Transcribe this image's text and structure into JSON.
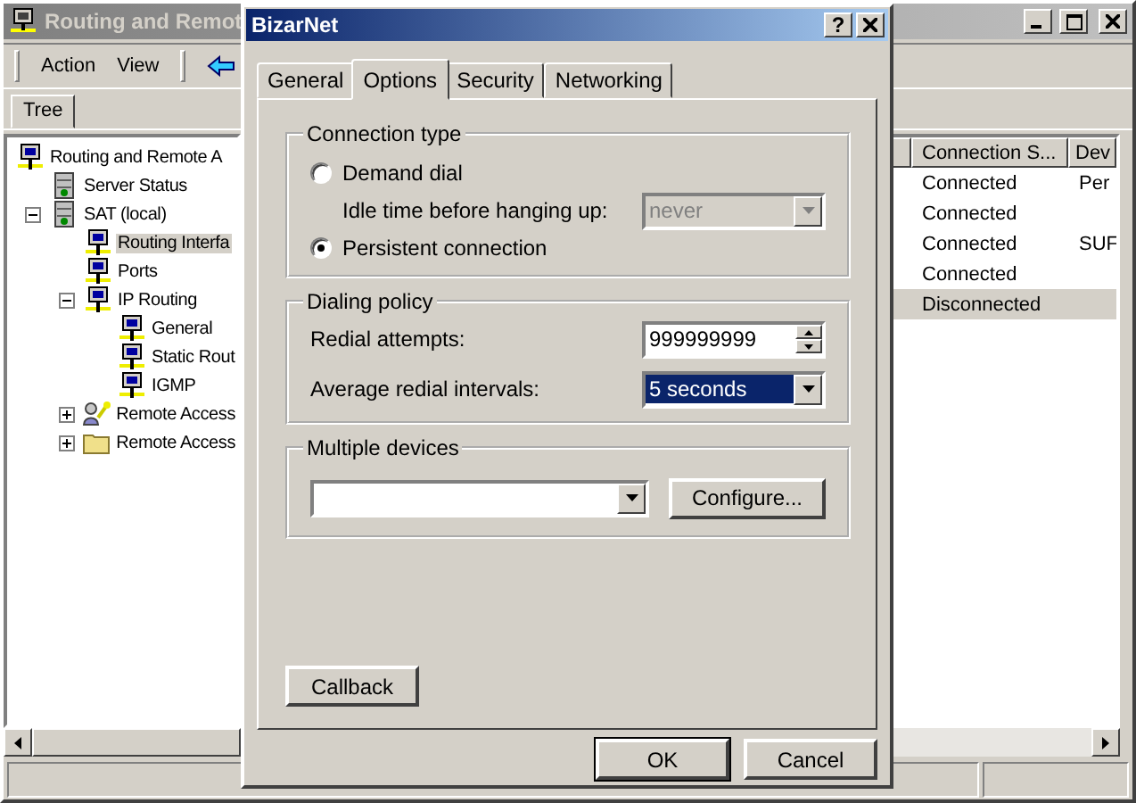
{
  "main_window": {
    "title": "Routing and Remot",
    "menu": [
      "Action",
      "View"
    ],
    "tree_tab": "Tree",
    "tree": [
      {
        "label": "Routing and Remote A",
        "kind": "computer",
        "selected": false,
        "children": [
          {
            "label": "Server Status",
            "kind": "server",
            "selected": false
          },
          {
            "label": "SAT (local)",
            "kind": "server",
            "selected": false,
            "expanded": true,
            "children": [
              {
                "label": "Routing Interfa",
                "kind": "computer",
                "selected": true
              },
              {
                "label": "Ports",
                "kind": "computer",
                "selected": false
              },
              {
                "label": "IP Routing",
                "kind": "computer",
                "selected": false,
                "expanded": true,
                "children": [
                  {
                    "label": "General",
                    "kind": "computer",
                    "selected": false
                  },
                  {
                    "label": "Static Rout",
                    "kind": "computer",
                    "selected": false
                  },
                  {
                    "label": "IGMP",
                    "kind": "computer",
                    "selected": false
                  }
                ]
              },
              {
                "label": "Remote Access",
                "kind": "policy",
                "selected": false,
                "expanded": false
              },
              {
                "label": "Remote Access",
                "kind": "folder",
                "selected": false,
                "expanded": false
              }
            ]
          }
        ]
      }
    ],
    "list": {
      "columns": [
        "Connection S...",
        "Dev"
      ],
      "rows": [
        {
          "cells": [
            "Connected",
            "Per"
          ],
          "selected": false
        },
        {
          "cells": [
            "Connected",
            ""
          ],
          "selected": false
        },
        {
          "cells": [
            "Connected",
            "SUF"
          ],
          "selected": false
        },
        {
          "cells": [
            "Connected",
            ""
          ],
          "selected": false
        },
        {
          "cells": [
            "Disconnected",
            ""
          ],
          "selected": true
        }
      ]
    }
  },
  "dialog": {
    "title": "BizarNet",
    "help": "?",
    "tabs": [
      {
        "label": "General",
        "selected": false
      },
      {
        "label": "Options",
        "selected": true
      },
      {
        "label": "Security",
        "selected": false
      },
      {
        "label": "Networking",
        "selected": false
      }
    ],
    "connection_type": {
      "title": "Connection type",
      "options": [
        {
          "label": "Demand dial",
          "selected": false
        },
        {
          "label": "Persistent connection",
          "selected": true
        }
      ],
      "idle": {
        "label": "Idle time before hanging up:",
        "value": "never",
        "disabled": true
      }
    },
    "dialing_policy": {
      "title": "Dialing policy",
      "redial_label": "Redial attempts:",
      "redial_value": "999999999",
      "interval_label": "Average redial intervals:",
      "interval_value": "5 seconds",
      "interval_focused": true
    },
    "multiple_devices": {
      "title": "Multiple devices",
      "button": "Configure..."
    },
    "callback": "Callback",
    "buttons": [
      {
        "label": "OK",
        "default": true
      },
      {
        "label": "Cancel",
        "default": false
      }
    ]
  }
}
